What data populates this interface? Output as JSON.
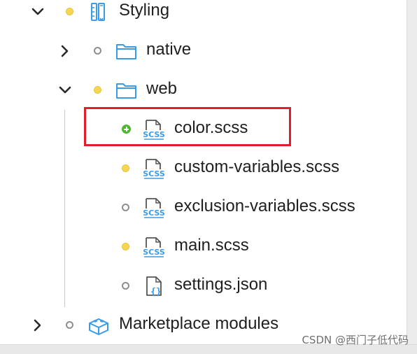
{
  "tree": {
    "styling": {
      "label": "Styling",
      "status": "yellow",
      "expanded": true,
      "icon": "styling-ruler-icon"
    },
    "native": {
      "label": "native",
      "status": "empty",
      "expanded": false,
      "icon": "folder-icon"
    },
    "web": {
      "label": "web",
      "status": "yellow",
      "expanded": true,
      "icon": "folder-icon"
    },
    "files": [
      {
        "label": "color.scss",
        "status": "added",
        "icon": "scss-file-icon",
        "highlighted": true
      },
      {
        "label": "custom-variables.scss",
        "status": "yellow",
        "icon": "scss-file-icon"
      },
      {
        "label": "exclusion-variables.scss",
        "status": "empty",
        "icon": "scss-file-icon"
      },
      {
        "label": "main.scss",
        "status": "yellow",
        "icon": "scss-file-icon"
      },
      {
        "label": "settings.json",
        "status": "empty",
        "icon": "json-file-icon"
      }
    ],
    "marketplace": {
      "label": "Marketplace modules",
      "status": "empty",
      "expanded": false,
      "icon": "blocks-icon"
    }
  },
  "watermark": "CSDN @西门子低代码",
  "colors": {
    "highlight_border": "#e11f2a",
    "modified": "#f7d654",
    "added": "#50b531",
    "icon_blue": "#3c9be6"
  }
}
